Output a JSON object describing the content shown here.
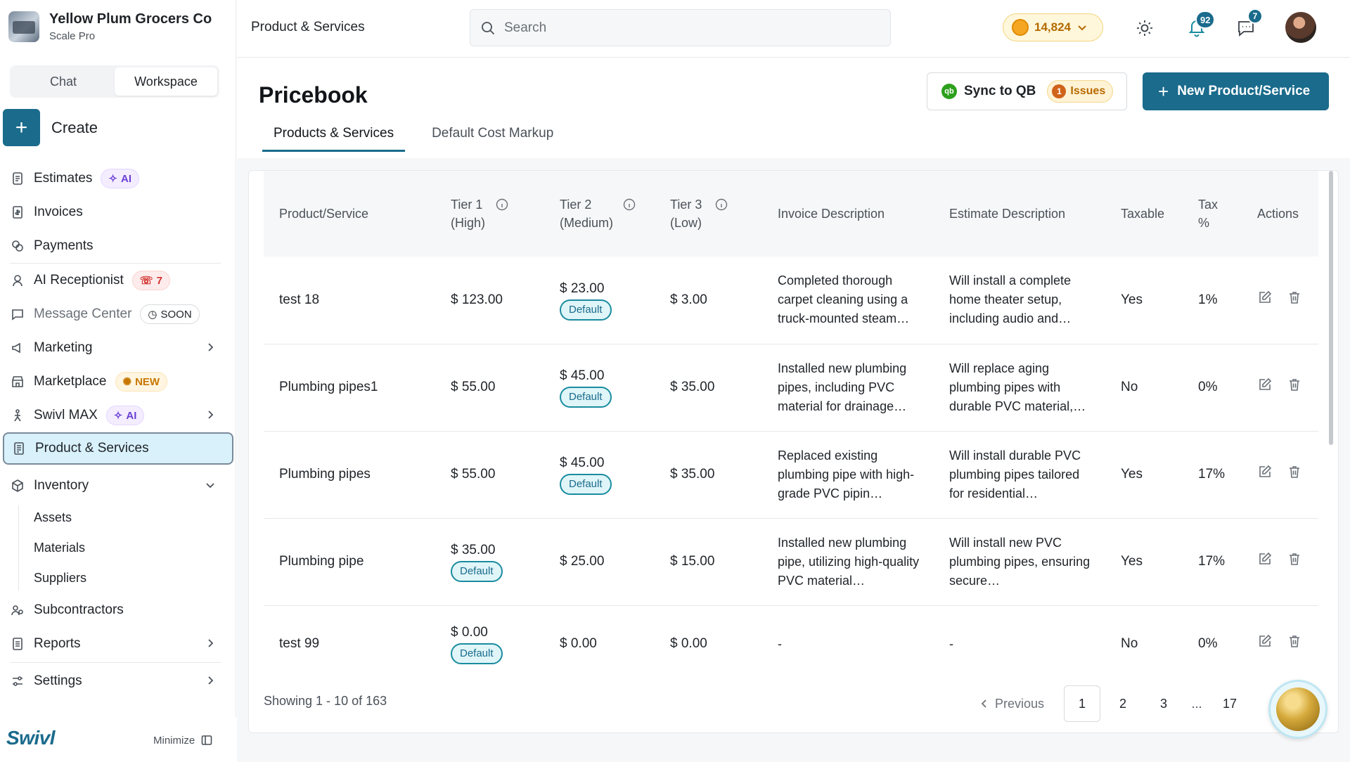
{
  "org": {
    "name": "Yellow Plum Grocers Co",
    "plan": "Scale Pro"
  },
  "sidebar": {
    "segments": [
      "Chat",
      "Workspace"
    ],
    "create_label": "Create",
    "items": [
      {
        "label": "Estimates",
        "badge": "AI"
      },
      {
        "label": "Invoices"
      },
      {
        "label": "Payments"
      },
      {
        "label": "AI Receptionist",
        "badge": "7"
      },
      {
        "label": "Message Center",
        "badge": "SOON"
      },
      {
        "label": "Marketing"
      },
      {
        "label": "Marketplace",
        "badge": "NEW"
      },
      {
        "label": "Swivl MAX",
        "badge": "AI"
      },
      {
        "label": "Product & Services"
      },
      {
        "label": "Inventory"
      },
      {
        "label": "Subcontractors"
      },
      {
        "label": "Reports"
      },
      {
        "label": "Settings"
      }
    ],
    "inventory_sub": [
      "Assets",
      "Materials",
      "Suppliers"
    ],
    "brand": "Swivl",
    "minimize_label": "Minimize"
  },
  "topbar": {
    "title": "Product & Services",
    "search_placeholder": "Search",
    "coins": "14,824",
    "notifications_count": "92",
    "messages_count": "7"
  },
  "page": {
    "title": "Pricebook",
    "tabs": [
      "Products & Services",
      "Default Cost Markup"
    ],
    "sync_label": "Sync to QB",
    "qb_mark": "qb",
    "issues_count": "1",
    "issues_label": "Issues",
    "new_button_label": "New Product/Service"
  },
  "table": {
    "columns": [
      "Product/Service",
      "Tier 1 (High)",
      "Tier 2 (Medium)",
      "Tier 3 (Low)",
      "Invoice Description",
      "Estimate Description",
      "Taxable",
      "Tax %",
      "Actions"
    ],
    "default_label": "Default",
    "rows": [
      {
        "name": "test 18",
        "tier1": "$ 123.00",
        "tier2": "$ 23.00",
        "tier3": "$ 3.00",
        "invoice_desc": "Completed thorough carpet cleaning using a truck-mounted steam…",
        "estimate_desc": "Will install a complete home theater setup, including audio and…",
        "taxable": "Yes",
        "tax": "1%"
      },
      {
        "name": "Plumbing pipes1",
        "tier1": "$ 55.00",
        "tier2": "$ 45.00",
        "tier3": "$ 35.00",
        "invoice_desc": "Installed new plumbing pipes, including PVC material for drainage…",
        "estimate_desc": "Will replace aging plumbing pipes with durable PVC material,…",
        "taxable": "No",
        "tax": "0%"
      },
      {
        "name": "Plumbing pipes",
        "tier1": "$ 55.00",
        "tier2": "$ 45.00",
        "tier3": "$ 35.00",
        "invoice_desc": "Replaced existing plumbing pipe with high-grade PVC pipin…",
        "estimate_desc": "Will install durable PVC plumbing pipes tailored for residential…",
        "taxable": "Yes",
        "tax": "17%"
      },
      {
        "name": "Plumbing pipe",
        "tier1": "$ 35.00",
        "tier2": "$ 25.00",
        "tier3": "$ 15.00",
        "invoice_desc": "Installed new plumbing pipe, utilizing high-quality PVC material…",
        "estimate_desc": "Will install new PVC plumbing pipes, ensuring secure…",
        "taxable": "Yes",
        "tax": "17%"
      },
      {
        "name": "test 99",
        "tier1": "$ 0.00",
        "tier2": "$ 0.00",
        "tier3": "$ 0.00",
        "invoice_desc": "-",
        "estimate_desc": "-",
        "taxable": "No",
        "tax": "0%"
      }
    ]
  },
  "pagination": {
    "showing": "Showing 1 - 10 of 163",
    "previous": "Previous",
    "pages": [
      "1",
      "2",
      "3",
      "...",
      "17"
    ]
  }
}
